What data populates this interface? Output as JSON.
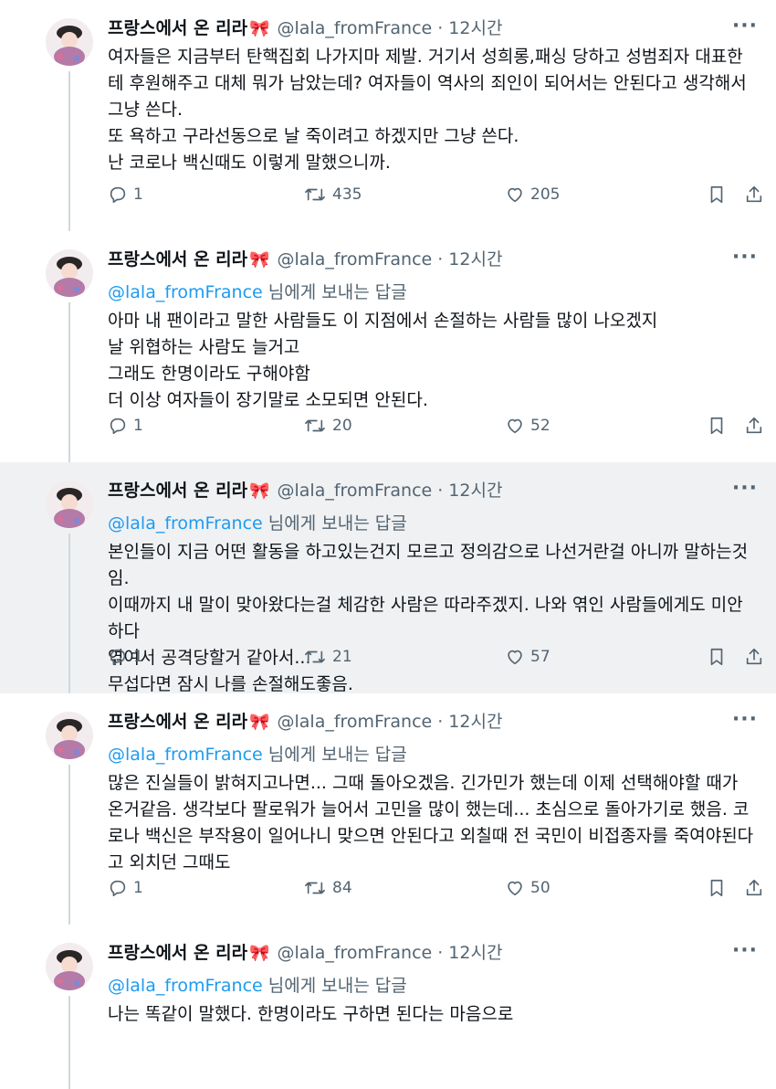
{
  "author": {
    "name": "프랑스에서 온 리라",
    "name_emoji": "🎀",
    "handle": "@lala_fromFrance",
    "time": "12시간",
    "separator": "·"
  },
  "reply_to": {
    "mention": "@lala_fromFrance",
    "suffix": " 님에게 보내는 답글"
  },
  "more_label": "···",
  "tweets": [
    {
      "is_reply": false,
      "text": "여자들은 지금부터 탄핵집회 나가지마 제발. 거기서 성희롱,패싱 당하고 성범죄자 대표한테 후원해주고 대체 뭐가 남았는데? 여자들이 역사의 죄인이 되어서는 안된다고 생각해서 그냥 쓴다.\n또 욕하고 구라선동으로 날 죽이려고 하겠지만 그냥 쓴다.\n난 코로나 백신때도 이렇게 말했으니까.",
      "replies": "1",
      "retweets": "435",
      "likes": "205"
    },
    {
      "is_reply": true,
      "text": "아마 내 팬이라고 말한 사람들도 이 지점에서 손절하는 사람들 많이 나오겠지\n날 위협하는 사람도 늘거고\n그래도 한명이라도 구해야함\n더 이상 여자들이 장기말로 소모되면 안된다.",
      "replies": "1",
      "retweets": "20",
      "likes": "52"
    },
    {
      "is_reply": true,
      "text": "본인들이 지금 어떤 활동을 하고있는건지 모르고 정의감으로 나선거란걸 아니까 말하는것임.\n이때까지 내 말이 맞아왔다는걸 체감한 사람은 따라주겠지. 나와 엮인 사람들에게도 미안하다\n엮여서 공격당할거 같아서...\n무섭다면 잠시 나를 손절해도좋음.",
      "replies": "1",
      "retweets": "21",
      "likes": "57"
    },
    {
      "is_reply": true,
      "text": "많은 진실들이 밝혀지고나면... 그때 돌아오겠음. 긴가민가 했는데 이제 선택해야할 때가 온거같음. 생각보다 팔로워가 늘어서 고민을 많이 했는데... 초심으로 돌아가기로 했음. 코로나 백신은 부작용이 일어나니 맞으면 안된다고 외칠때 전 국민이 비접종자를 죽여야된다고 외치던 그때도",
      "replies": "1",
      "retweets": "84",
      "likes": "50"
    },
    {
      "is_reply": true,
      "text": "나는 똑같이 말했다. 한명이라도 구하면 된다는 마음으로"
    }
  ],
  "colors": {
    "link": "#1d9bf0",
    "secondary": "#536471",
    "highlight_bg": "#f0f1f3",
    "ribbon": "#e0263f"
  },
  "icons": [
    "reply-icon",
    "retweet-icon",
    "like-icon",
    "bookmark-icon",
    "share-icon",
    "more-icon",
    "ribbon-emoji"
  ]
}
